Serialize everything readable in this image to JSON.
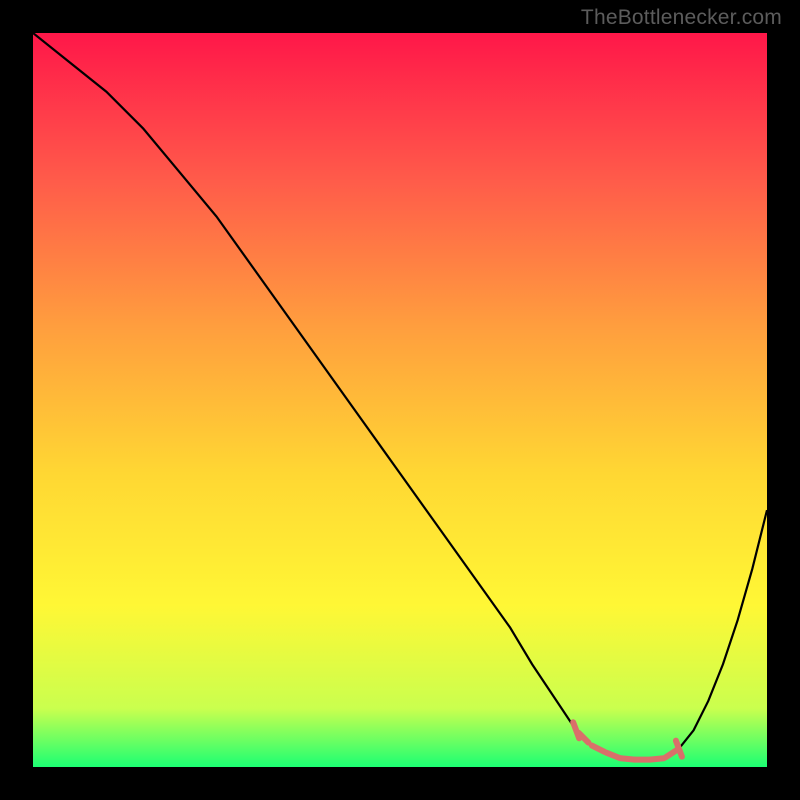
{
  "watermark": "TheBottlenecker.com",
  "chart_data": {
    "type": "line",
    "title": "",
    "xlabel": "",
    "ylabel": "",
    "xlim": [
      0,
      100
    ],
    "ylim": [
      0,
      100
    ],
    "grid": false,
    "series": [
      {
        "name": "curve",
        "stroke": "#000000",
        "x": [
          0,
          5,
          10,
          15,
          20,
          25,
          30,
          35,
          40,
          45,
          50,
          55,
          60,
          65,
          68,
          70,
          72,
          74,
          76,
          78,
          80,
          82,
          84,
          86,
          88,
          90,
          92,
          94,
          96,
          98,
          100
        ],
        "y": [
          100,
          96,
          92,
          87,
          81,
          75,
          68,
          61,
          54,
          47,
          40,
          33,
          26,
          19,
          14,
          11,
          8,
          5,
          3,
          2,
          1.2,
          1.0,
          1.0,
          1.2,
          2.5,
          5,
          9,
          14,
          20,
          27,
          35
        ]
      },
      {
        "name": "valley-highlight",
        "stroke": "#d9706a",
        "x": [
          74,
          76,
          78,
          80,
          82,
          84,
          86,
          88
        ],
        "y": [
          5,
          3,
          2,
          1.2,
          1.0,
          1.0,
          1.2,
          2.5
        ]
      }
    ],
    "background": {
      "type": "vertical-gradient",
      "stops": [
        {
          "offset": 0.0,
          "color": "#ff1749"
        },
        {
          "offset": 0.2,
          "color": "#ff5b4a"
        },
        {
          "offset": 0.4,
          "color": "#ff9e3e"
        },
        {
          "offset": 0.6,
          "color": "#ffd733"
        },
        {
          "offset": 0.78,
          "color": "#fff735"
        },
        {
          "offset": 0.92,
          "color": "#caff4e"
        },
        {
          "offset": 1.0,
          "color": "#1cff73"
        }
      ]
    }
  }
}
